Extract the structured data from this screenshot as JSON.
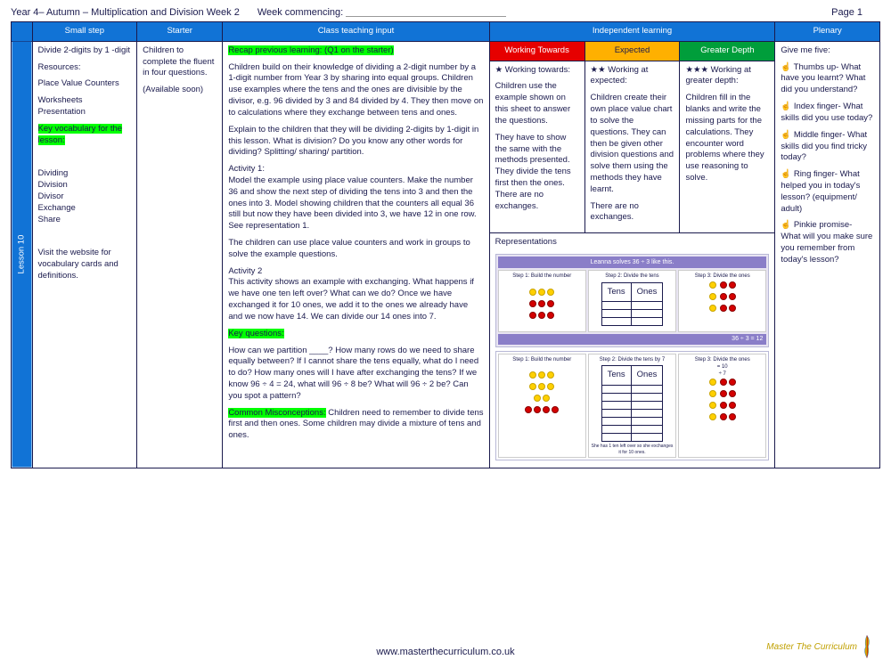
{
  "header": {
    "title": "Year 4– Autumn – Multiplication and Division Week 2",
    "week_commencing_label": "Week commencing:",
    "page_label": "Page 1"
  },
  "columns": {
    "small_step": "Small step",
    "starter": "Starter",
    "class_input": "Class teaching input",
    "independent": "Independent learning",
    "plenary": "Plenary"
  },
  "lesson_tab": "Lesson 10",
  "small_step": {
    "title": "Divide 2-digits by 1 -digit",
    "resources_label": "Resources:",
    "resources": [
      "Place Value Counters",
      "Worksheets",
      "Presentation"
    ],
    "vocab_label": "Key vocabulary for the lesson:",
    "vocab": [
      "Dividing",
      "Division",
      "Divisor",
      "Exchange",
      "Share"
    ],
    "note": "Visit the website for vocabulary cards and definitions."
  },
  "starter": {
    "line1": "Children to complete the fluent in four questions.",
    "line2": "(Available soon)"
  },
  "teaching": {
    "recap": "Recap previous learning: (Q1 on the starter)",
    "p1": "Children build on their knowledge of dividing a 2-digit number by a 1-digit number from Year 3 by sharing into equal groups. Children use examples where the tens and the ones are divisible by the divisor, e.g. 96 divided by 3 and 84 divided by 4. They then move on to calculations where they exchange between tens and ones.",
    "p2": "Explain to the children that they will be dividing 2-digits by 1-digit in this lesson. What is division? Do you know any other words for dividing? Splitting/ sharing/ partition.",
    "a1_label": "Activity 1:",
    "a1": "Model the example using place value counters. Make the number 36 and show the next step of dividing the tens into 3 and then the ones into 3. Model showing children that the counters all equal 36 still but now they have been divided into 3, we have 12 in one row. See representation 1.",
    "a1b": "The children can use place value counters and work in groups to solve the example questions.",
    "a2_label": "Activity 2",
    "a2": "This activity shows an example with exchanging. What happens if we have one ten left over? What can we do? Once we have exchanged it for 10 ones, we add it to the ones we already have and we now have 14. We can divide our 14 ones into 7.",
    "kq_label": "Key questions:",
    "kq": "How can we partition ____? How many rows do we need to share equally between? If I cannot share the tens equally, what do I need to do? How many ones will I have after exchanging the tens? If we know 96 ÷ 4 = 24, what will 96 ÷ 8 be? What will 96 ÷ 2 be? Can you spot a pattern?",
    "misc_label": "Common Misconceptions:",
    "misc": " Children need to remember to divide tens first and then ones. Some children may divide a mixture of tens and ones."
  },
  "independent": {
    "wt_hdr": "Working Towards",
    "exp_hdr": "Expected",
    "gd_hdr": "Greater Depth",
    "wt_title": "★ Working towards:",
    "wt_body": "Children use the example shown on this sheet to answer the questions.",
    "wt_body2": "They have to show the same with the methods presented. They divide the tens first then the ones. There are no exchanges.",
    "exp_title": "★★ Working at expected:",
    "exp_body": "Children create their own place value chart to solve the questions. They can then be given other division questions and solve them using the methods they have learnt.",
    "exp_body2": "There are no exchanges.",
    "gd_title": "★★★ Working at greater depth:",
    "gd_body": "Children fill in the blanks and write the missing parts for the calculations. They encounter word problems where they use reasoning to solve.",
    "reps_label": "Representations",
    "rep1_title": "Leanna solves 36 ÷ 3 like this.",
    "rep1_steps": [
      "Step 1: Build the number",
      "Step 2: Divide the tens",
      "Step 3: Divide the ones"
    ],
    "rep1_answer": "36 ÷ 3 = 12",
    "rep2_steps": [
      "Step 1: Build the number",
      "Step 2: Divide the tens by 7",
      "Step 3: Divide the ones"
    ],
    "rep2_note": "She has 1 ten left over so she exchanges it for 10 ones."
  },
  "plenary": {
    "intro": "Give me five:",
    "thumb": "☝ Thumbs up- What have you learnt? What did you understand?",
    "index": "☝ Index finger- What skills did you use today?",
    "middle": "☝ Middle finger- What skills did you find tricky today?",
    "ring": "☝ Ring finger- What helped you in today's lesson? (equipment/ adult)",
    "pinkie": "☝ Pinkie promise- What will you make sure you remember from today's lesson?"
  },
  "footer": {
    "url": "www.masterthecurriculum.co.uk",
    "logo": "Master The Curriculum"
  }
}
